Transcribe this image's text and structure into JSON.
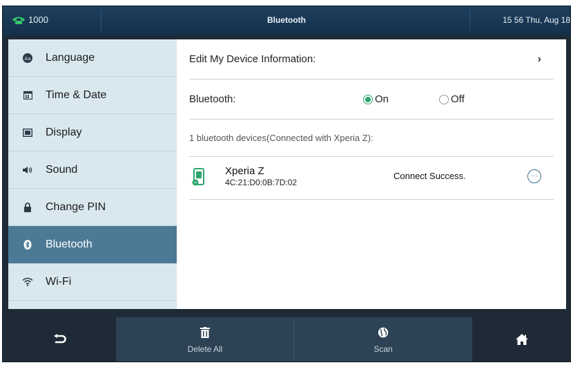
{
  "status": {
    "line_label": "1000",
    "title": "Bluetooth",
    "clock": "15 56 Thu, Aug 18"
  },
  "sidebar": {
    "items": [
      {
        "label": "Language",
        "icon": "language-icon"
      },
      {
        "label": "Time & Date",
        "icon": "calendar-icon"
      },
      {
        "label": "Display",
        "icon": "display-icon"
      },
      {
        "label": "Sound",
        "icon": "speaker-icon"
      },
      {
        "label": "Change PIN",
        "icon": "lock-icon"
      },
      {
        "label": "Bluetooth",
        "icon": "bluetooth-icon",
        "active": true
      },
      {
        "label": "Wi-Fi",
        "icon": "wifi-icon"
      }
    ]
  },
  "main": {
    "edit_device_label": "Edit My Device Information:",
    "edit_device_chevron": "›",
    "bluetooth_label": "Bluetooth:",
    "on_label": "On",
    "off_label": "Off",
    "bluetooth_state": "On",
    "device_count_text": "1 bluetooth devices(Connected with  Xperia Z):",
    "device": {
      "name": "Xperia Z",
      "mac": "4C:21:D0:0B:7D:02",
      "status": "Connect Success.",
      "more_label": "···"
    }
  },
  "softkeys": {
    "back_icon": "back-arrow-icon",
    "delete_all_label": "Delete All",
    "scan_label": "Scan",
    "home_icon": "home-icon"
  },
  "colors": {
    "accent_green": "#2ea56b",
    "sidebar_bg": "#d9e8ef",
    "sidebar_active": "#4c7a96",
    "statusbar": "#1f3f5d"
  }
}
